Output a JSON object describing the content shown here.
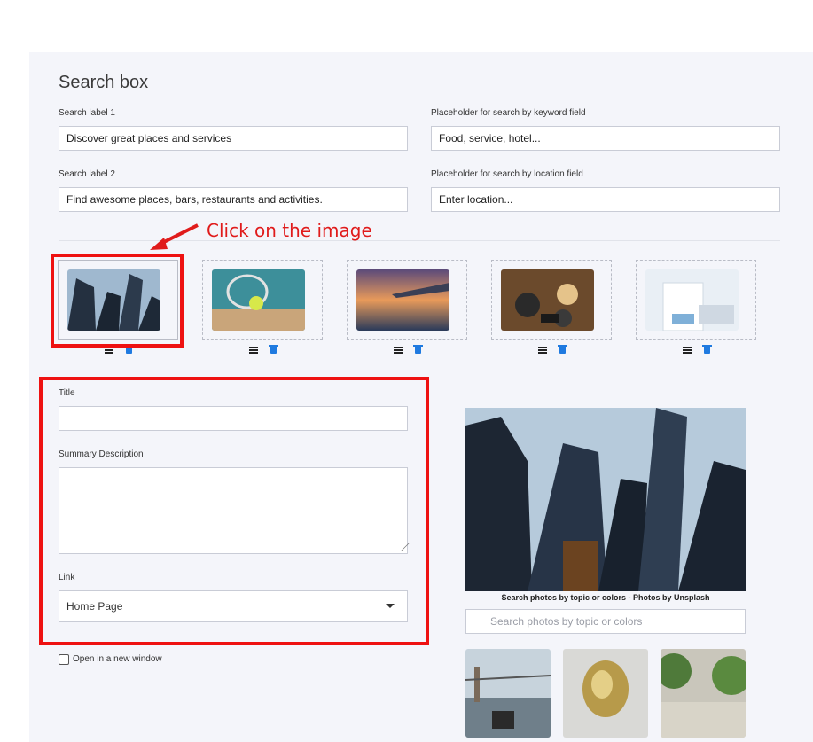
{
  "section": {
    "title": "Search box"
  },
  "fields": {
    "search_label_1": {
      "label": "Search label 1",
      "value": "Discover great places and services"
    },
    "placeholder_keyword": {
      "label": "Placeholder for search by keyword field",
      "value": "Food, service, hotel..."
    },
    "search_label_2": {
      "label": "Search label 2",
      "value": "Find awesome places, bars, restaurants and activities."
    },
    "placeholder_location": {
      "label": "Placeholder for search by location field",
      "value": "Enter location..."
    }
  },
  "annotation": {
    "text": "Click on the image",
    "color": "#e01b1b"
  },
  "thumbnails": [
    {
      "icon": "skyscrapers-image",
      "selected": true
    },
    {
      "icon": "tennis-image",
      "selected": false
    },
    {
      "icon": "airplane-wing-image",
      "selected": false
    },
    {
      "icon": "restaurant-table-image",
      "selected": false
    },
    {
      "icon": "doctor-image",
      "selected": false
    }
  ],
  "form": {
    "title_label": "Title",
    "title_value": "",
    "summary_label": "Summary Description",
    "summary_value": "",
    "link_label": "Link",
    "link_value": "Home Page",
    "new_window_label": "Open in a new window"
  },
  "unsplash": {
    "caption": "Search photos by topic or colors - Photos by Unsplash",
    "search_placeholder": "Search photos by topic or colors",
    "results": [
      "bridge-binoculars-image",
      "gold-sculpture-image",
      "street-trees-image"
    ]
  },
  "colors": {
    "accent": "#1f7ae0",
    "highlight": "#ee1111",
    "panel": "#f4f5fa"
  }
}
